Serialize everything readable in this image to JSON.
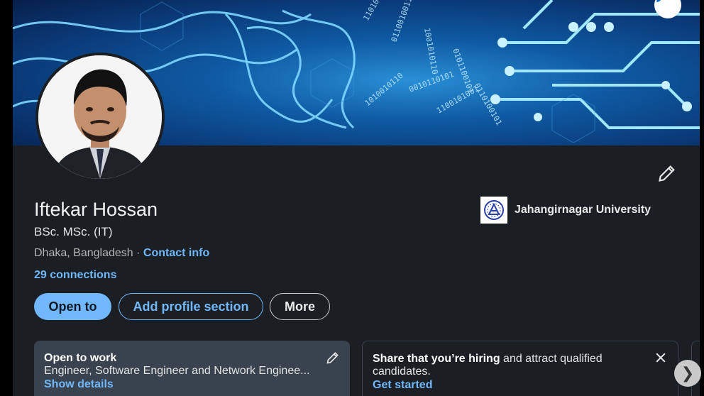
{
  "profile": {
    "name": "Iftekar Hossan",
    "headline": "BSc. MSc. (IT)",
    "location": "Dhaka, Bangladesh",
    "contact_info_label": "Contact info",
    "connections": "29 connections"
  },
  "education": {
    "name": "Jahangirnagar University",
    "logo_icon": "university-logo-icon"
  },
  "actions": {
    "open_to": "Open to",
    "add_section": "Add profile section",
    "more": "More"
  },
  "open_to_work": {
    "title": "Open to work",
    "roles": "Engineer, Software Engineer and Network Enginee...",
    "link": "Show details"
  },
  "hiring": {
    "title_bold": "Share that you’re hiring",
    "title_rest": " and attract qualified",
    "title_line2": "candidates.",
    "link": "Get started"
  },
  "colors": {
    "accent": "#71b7fb",
    "card_bg": "#1b1f23",
    "panel_bg": "#38434f"
  }
}
